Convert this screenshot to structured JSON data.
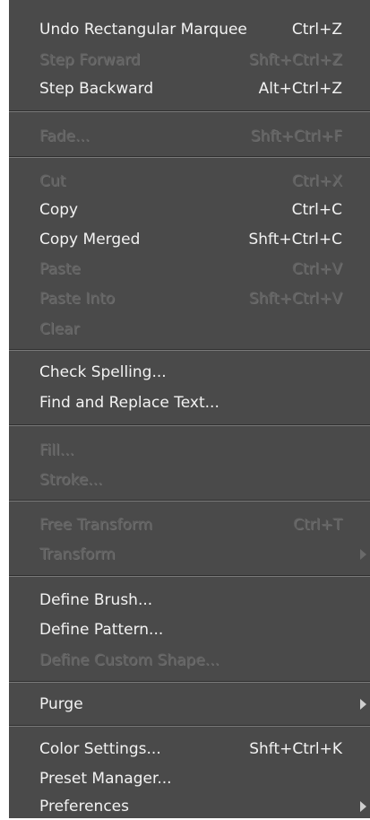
{
  "menu": {
    "undo": {
      "label": "Undo Rectangular Marquee",
      "shortcut": "Ctrl+Z"
    },
    "step_forward": {
      "label": "Step Forward",
      "shortcut": "Shft+Ctrl+Z"
    },
    "step_backward": {
      "label": "Step Backward",
      "shortcut": "Alt+Ctrl+Z"
    },
    "fade": {
      "label": "Fade...",
      "shortcut": "Shft+Ctrl+F"
    },
    "cut": {
      "label": "Cut",
      "shortcut": "Ctrl+X"
    },
    "copy": {
      "label": "Copy",
      "shortcut": "Ctrl+C"
    },
    "copy_merged": {
      "label": "Copy Merged",
      "shortcut": "Shft+Ctrl+C"
    },
    "paste": {
      "label": "Paste",
      "shortcut": "Ctrl+V"
    },
    "paste_into": {
      "label": "Paste Into",
      "shortcut": "Shft+Ctrl+V"
    },
    "clear": {
      "label": "Clear"
    },
    "check_spelling": {
      "label": "Check Spelling..."
    },
    "find_replace": {
      "label": "Find and Replace Text..."
    },
    "fill": {
      "label": "Fill..."
    },
    "stroke": {
      "label": "Stroke..."
    },
    "free_transform": {
      "label": "Free Transform",
      "shortcut": "Ctrl+T"
    },
    "transform": {
      "label": "Transform"
    },
    "define_brush": {
      "label": "Define Brush..."
    },
    "define_pattern": {
      "label": "Define Pattern..."
    },
    "define_custom_shape": {
      "label": "Define Custom Shape..."
    },
    "purge": {
      "label": "Purge"
    },
    "color_settings": {
      "label": "Color Settings...",
      "shortcut": "Shft+Ctrl+K"
    },
    "preset_manager": {
      "label": "Preset Manager..."
    },
    "preferences": {
      "label": "Preferences"
    }
  },
  "colors": {
    "menu_bg": "#4a4a4a",
    "text_enabled": "#f2f2f2",
    "text_disabled": "#626262"
  },
  "icons": {
    "submenu": "submenu-arrow-icon"
  }
}
